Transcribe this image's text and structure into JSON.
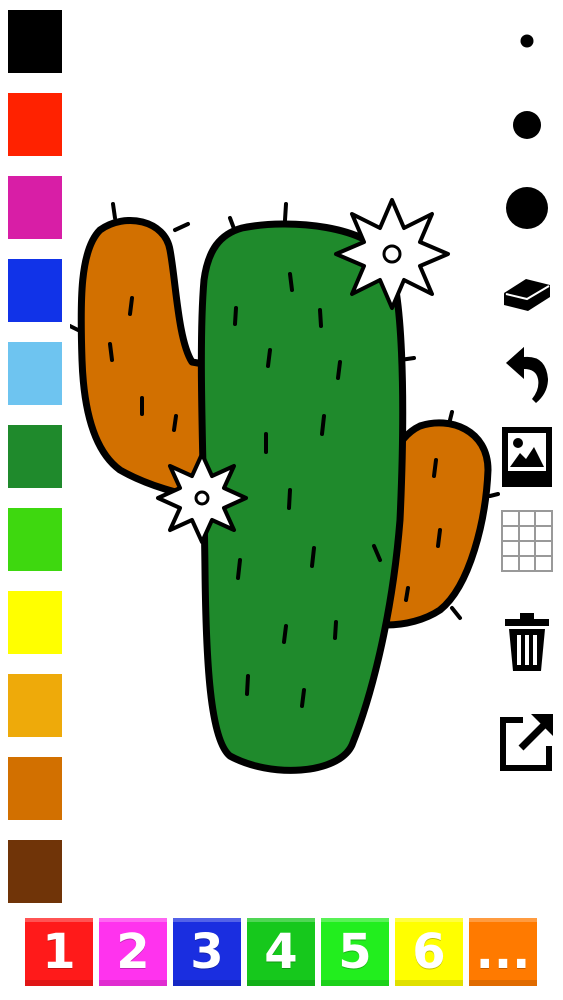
{
  "palette": {
    "colors": [
      "#000000",
      "#ff2200",
      "#d81ea6",
      "#1133e8",
      "#6ec4f0",
      "#1f8a2c",
      "#3ed80f",
      "#ffff00",
      "#eeaa0a",
      "#d27000",
      "#703408"
    ]
  },
  "tools": {
    "brush_small": "brush-size-small",
    "brush_medium": "brush-size-medium",
    "brush_large": "brush-size-large",
    "eraser": "eraser-icon",
    "undo": "undo-icon",
    "image": "image-icon",
    "grid": "grid-icon",
    "trash": "trash-icon",
    "share": "share-icon"
  },
  "drawing": {
    "subject": "cactus",
    "colors": {
      "outline": "#000000",
      "body": "#1f8a2c",
      "arms": "#d27000",
      "flowers": "#ffffff"
    }
  },
  "pages": {
    "tiles": [
      {
        "label": "1",
        "color": "#ff1a1a"
      },
      {
        "label": "2",
        "color": "#ff33ee"
      },
      {
        "label": "3",
        "color": "#1a2ee0"
      },
      {
        "label": "4",
        "color": "#16c81c"
      },
      {
        "label": "5",
        "color": "#22ee1e"
      },
      {
        "label": "6",
        "color": "#ffff00"
      },
      {
        "label": "...",
        "color": "#ff7a00"
      }
    ]
  }
}
